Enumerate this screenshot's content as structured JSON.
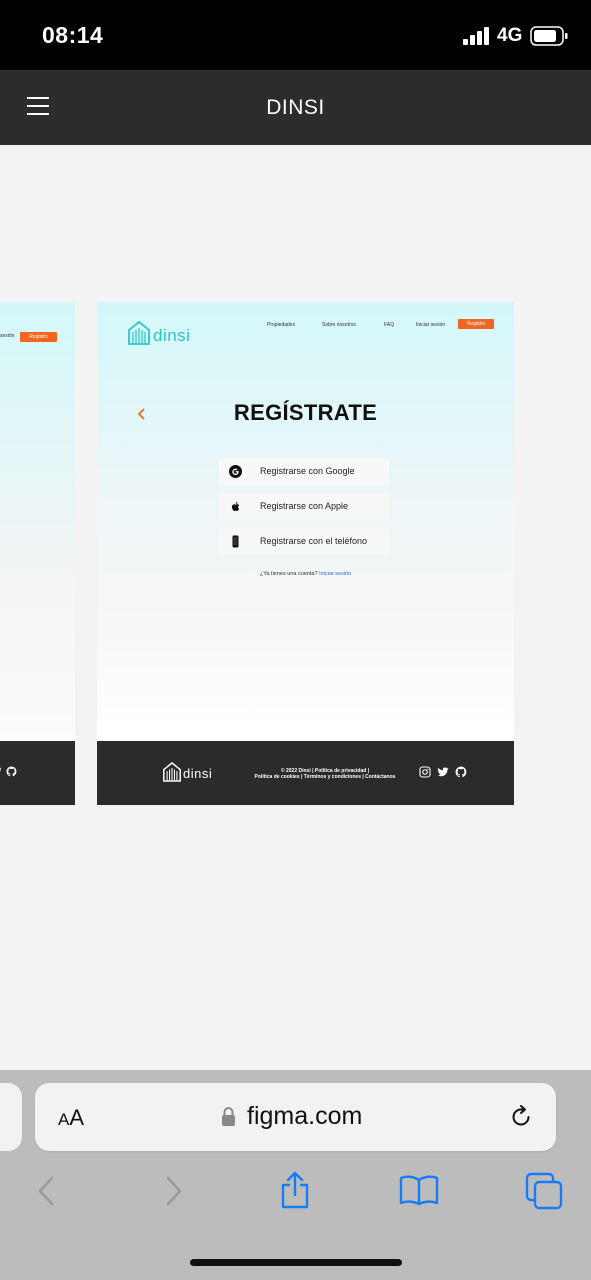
{
  "status_bar": {
    "time": "08:14",
    "network": "4G"
  },
  "figma_header": {
    "title": "DINSI"
  },
  "left_frame": {
    "nav_partial": "sesión",
    "register_button": "Registro"
  },
  "main_frame": {
    "logo_text": "dinsi",
    "nav": {
      "items": [
        "Propiedades",
        "Sobre nosotros",
        "FAQ",
        "Iniciar sesión"
      ],
      "register_button": "Registro"
    },
    "heading": "REGÍSTRATE",
    "options": [
      {
        "label": "Registrarse con Google",
        "icon": "google-icon"
      },
      {
        "label": "Registrarse con Apple",
        "icon": "apple-icon"
      },
      {
        "label": "Registrarse con el teléfono",
        "icon": "phone-icon"
      }
    ],
    "have_account": {
      "text": "¿Ya tienes una cuenta?",
      "link": "Iniciar sesión"
    },
    "footer": {
      "logo_text": "dinsi",
      "legal_line1": "© 2022 Dinsi | Política de privacidad |",
      "legal_line2": "Política de cookies | Términos y condiciones | Contáctanos",
      "social_icons": [
        "instagram-icon",
        "twitter-icon",
        "github-icon"
      ]
    },
    "colors": {
      "accent": "#f26522",
      "brand": "#2cc5cf",
      "footer": "#2b2b2b",
      "link": "#2d6be0"
    }
  },
  "browser": {
    "aa_label": "AA",
    "url": "figma.com",
    "toolbar": [
      "back-icon",
      "forward-icon",
      "share-icon",
      "bookmarks-icon",
      "tabs-icon"
    ]
  }
}
